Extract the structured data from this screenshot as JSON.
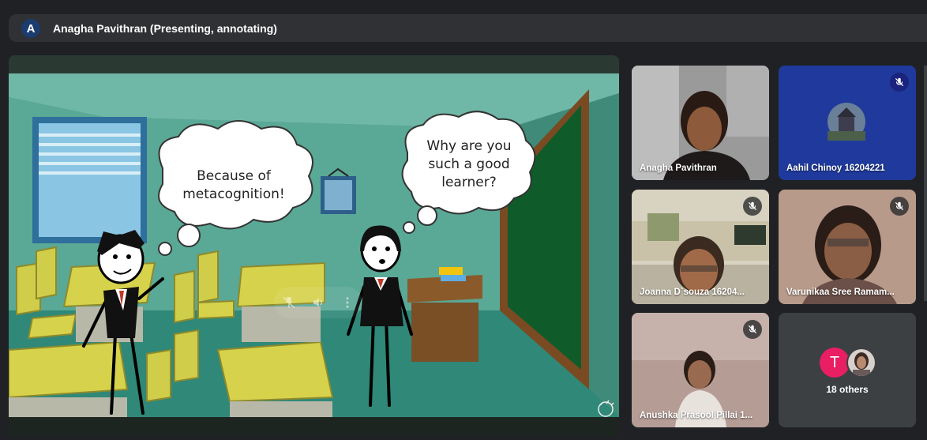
{
  "header": {
    "avatar_letter": "A",
    "presenter_label": "Anagha Pavithran (Presenting, annotating)"
  },
  "slide": {
    "bubble_left": [
      "Because of",
      "metacognition!"
    ],
    "bubble_right": [
      "Why are you",
      "such a good",
      "learner?"
    ],
    "controls": [
      "pin-off-icon",
      "volume-icon",
      "more-vert-icon"
    ]
  },
  "participants": [
    {
      "name": "Anagha Pavithran",
      "muted": false
    },
    {
      "name": "Aahil Chinoy 16204221",
      "muted": true
    },
    {
      "name": "Joanna D`souza 16204...",
      "muted": true
    },
    {
      "name": "Varunikaa Sree Ramam...",
      "muted": true
    },
    {
      "name": "Anushka Prasool Pillai 1...",
      "muted": true
    }
  ],
  "others": {
    "avatar_letter": "T",
    "label": "18 others"
  },
  "colors": {
    "accent_pink": "#e91e63",
    "avatar_blue": "#1a3c6e",
    "tile_bg": "#3c4043"
  }
}
